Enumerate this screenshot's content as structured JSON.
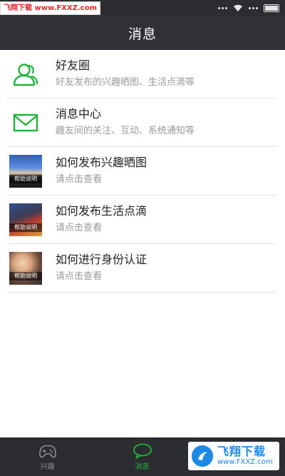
{
  "status_bar": {
    "watermark_text": "飞翔下载 www.FXXZ.com"
  },
  "header": {
    "title": "消息"
  },
  "list": {
    "items": [
      {
        "icon": "friends-icon",
        "title": "好友圈",
        "subtitle": "好友发布的兴趣晒图、生活点滴等"
      },
      {
        "icon": "envelope-icon",
        "title": "消息中心",
        "subtitle": "趣友间的关注、互动、系统通知等"
      },
      {
        "icon": "thumbnail-image",
        "caption": "帮助说明",
        "title": "如何发布兴趣晒图",
        "subtitle": "请点击查看"
      },
      {
        "icon": "thumbnail-image",
        "caption": "帮助说明",
        "title": "如何发布生活点滴",
        "subtitle": "请点击查看"
      },
      {
        "icon": "thumbnail-image",
        "caption": "帮助说明",
        "title": "如何进行身份认证",
        "subtitle": "请点击查看"
      }
    ]
  },
  "tab_bar": {
    "tabs": [
      {
        "label": "兴趣",
        "icon": "gamepad-icon",
        "active": false
      },
      {
        "label": "消息",
        "icon": "chat-bubble-icon",
        "active": true
      },
      {
        "label": "",
        "icon": "profile-icon",
        "active": false
      }
    ]
  },
  "watermark_bottom": {
    "title": "飞翔下载",
    "url": "www.FXXZ.com"
  },
  "colors": {
    "header_bg": "#2f3136",
    "accent_green": "#1fb33a",
    "tab_bar_bg": "#2b2d31",
    "watermark_red": "#e6262d",
    "watermark_blue": "#1e88e5"
  }
}
